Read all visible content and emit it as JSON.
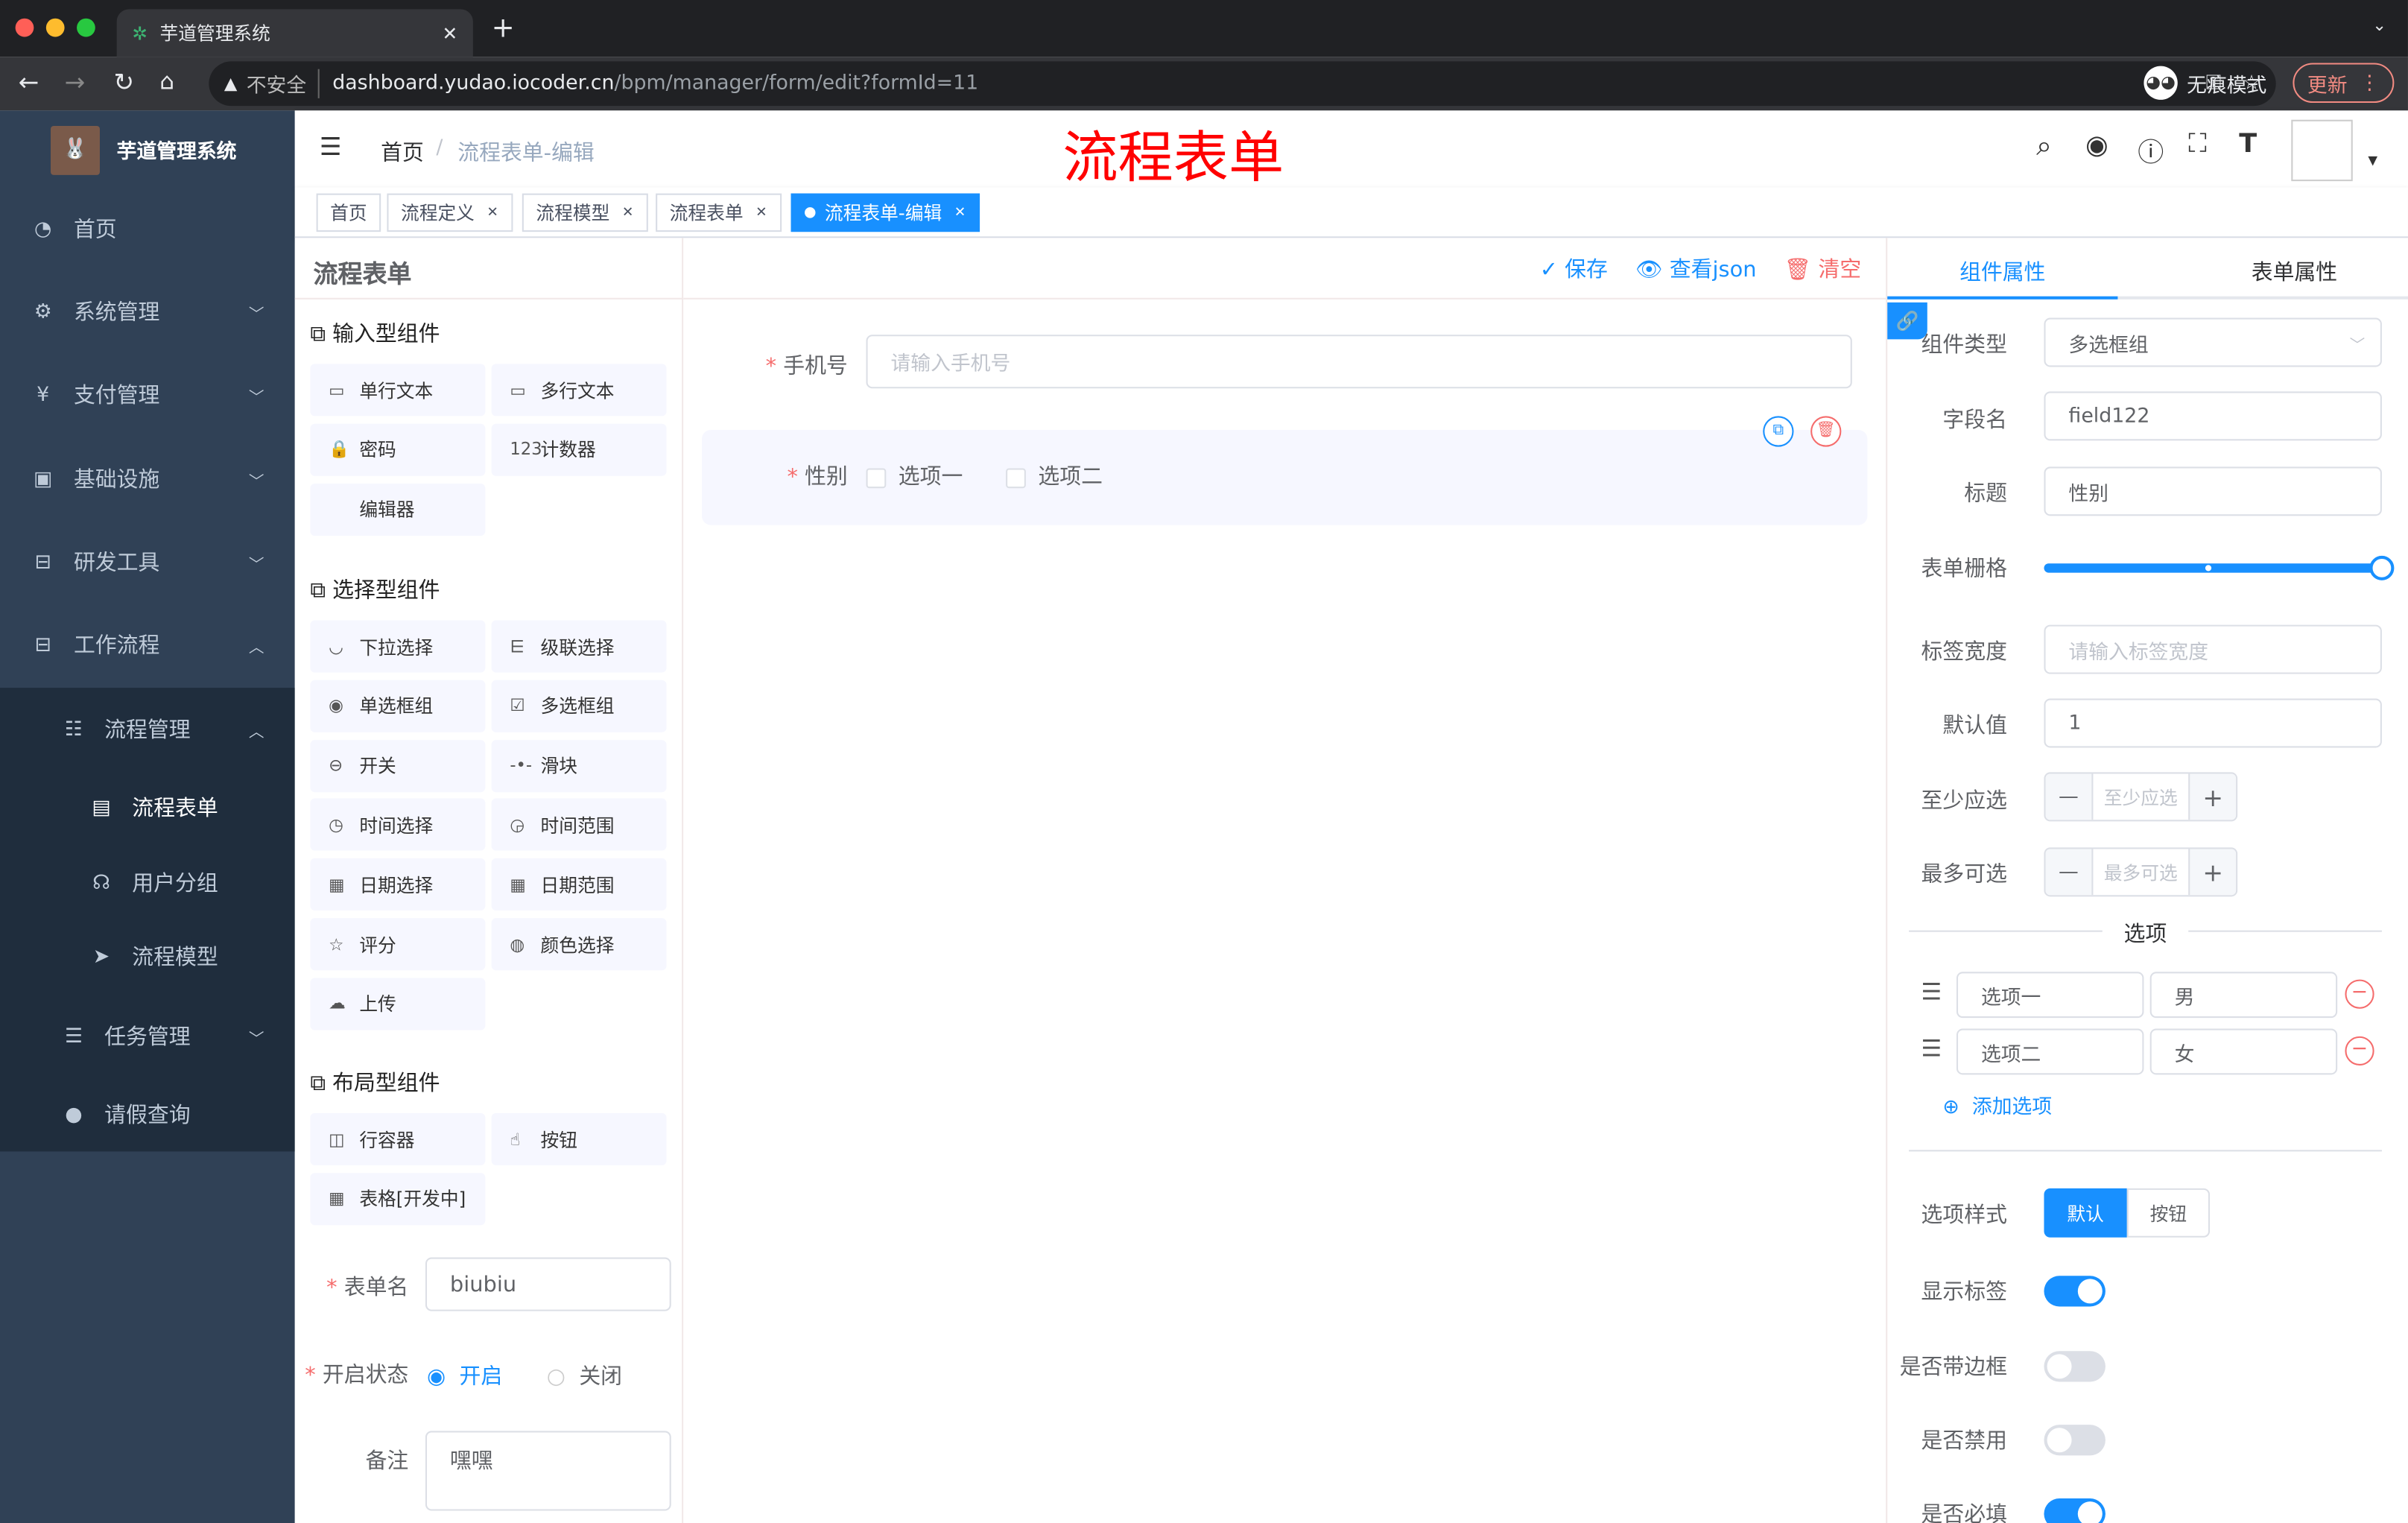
{
  "browser": {
    "tab_title": "芋道管理系统",
    "warning": "不安全",
    "url_host": "dashboard.yudao.iocoder.cn",
    "url_path": "/bpm/manager/form/edit?formId=11",
    "incognito": "无痕模式",
    "update": "更新"
  },
  "sidebar": {
    "title": "芋道管理系统",
    "items": [
      {
        "label": "首页",
        "icon": "dashboard-icon"
      },
      {
        "label": "系统管理",
        "icon": "gear-icon"
      },
      {
        "label": "支付管理",
        "icon": "yen-icon"
      },
      {
        "label": "基础设施",
        "icon": "monitor-icon"
      },
      {
        "label": "研发工具",
        "icon": "toolbox-icon"
      },
      {
        "label": "工作流程",
        "icon": "toolbox-icon"
      },
      {
        "label": "流程管理",
        "icon": "tree-icon"
      },
      {
        "label": "流程表单",
        "icon": "form-icon"
      },
      {
        "label": "用户分组",
        "icon": "group-icon"
      },
      {
        "label": "流程模型",
        "icon": "send-icon"
      },
      {
        "label": "任务管理",
        "icon": "list-icon"
      },
      {
        "label": "请假查询",
        "icon": "user-icon"
      }
    ]
  },
  "navbar": {
    "breadcrumb_home": "首页",
    "breadcrumb_current": "流程表单-编辑",
    "red_title": "流程表单"
  },
  "tags": [
    "首页",
    "流程定义",
    "流程模型",
    "流程表单",
    "流程表单-编辑"
  ],
  "header": {
    "title": "流程表单",
    "save": "保存",
    "view_json": "查看json",
    "clear": "清空"
  },
  "palette": {
    "groups": [
      "输入型组件",
      "选择型组件",
      "布局型组件"
    ],
    "input": [
      "单行文本",
      "多行文本",
      "密码",
      "计数器",
      "编辑器"
    ],
    "select": [
      "下拉选择",
      "级联选择",
      "单选框组",
      "多选框组",
      "开关",
      "滑块",
      "时间选择",
      "时间范围",
      "日期选择",
      "日期范围",
      "评分",
      "颜色选择",
      "上传"
    ],
    "layout": [
      "行容器",
      "按钮",
      "表格[开发中]"
    ],
    "form_name_label": "表单名",
    "form_name": "biubiu",
    "status_label": "开启状态",
    "status_on": "开启",
    "status_off": "关闭",
    "status_value": "开启",
    "remark_label": "备注",
    "remark": "嘿嘿"
  },
  "canvas": {
    "phone_label": "手机号",
    "phone_placeholder": "请输入手机号",
    "gender_label": "性别",
    "options": [
      "选项一",
      "选项二"
    ]
  },
  "props": {
    "tab_component": "组件属性",
    "tab_form": "表单属性",
    "type_label": "组件类型",
    "type": "多选框组",
    "field_label": "字段名",
    "field": "field122",
    "title_label": "标题",
    "title": "性别",
    "grid_label": "表单栅格",
    "grid_value": 24,
    "grid_max": 24,
    "labelwidth_label": "标签宽度",
    "labelwidth_placeholder": "请输入标签宽度",
    "default_label": "默认值",
    "default": "1",
    "min_label": "至少应选",
    "min_placeholder": "至少应选",
    "max_label": "最多可选",
    "max_placeholder": "最多可选",
    "options_title": "选项",
    "options": [
      {
        "label": "选项一",
        "value": "男"
      },
      {
        "label": "选项二",
        "value": "女"
      }
    ],
    "add_option": "添加选项",
    "style_label": "选项样式",
    "style_default": "默认",
    "style_button": "按钮",
    "show_label": "显示标签",
    "show_label_on": true,
    "border_label": "是否带边框",
    "border_on": false,
    "disabled_label": "是否禁用",
    "disabled_on": false,
    "required_label": "是否必填",
    "required_on": true
  },
  "colors": {
    "accent": "#1890ff",
    "sidebar": "#304156",
    "sidebar_sub": "#1f2d3d",
    "danger": "#f56c6c",
    "red_title": "#ff0000"
  }
}
